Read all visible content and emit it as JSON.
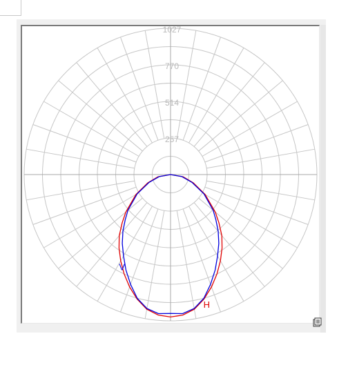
{
  "chart_data": {
    "type": "polar-line",
    "title": "",
    "radial_ticks": [
      "257",
      "514",
      "770",
      "1027"
    ],
    "radial_max": 1027,
    "angle_step_deg": 10,
    "series": [
      {
        "name": "H",
        "color": "#e00000",
        "label_angle_deg": 13,
        "angles_deg": [
          0,
          5,
          10,
          15,
          20,
          25,
          30,
          35,
          40,
          45,
          50,
          60,
          70,
          80,
          90
        ],
        "values": [
          1000,
          990,
          960,
          905,
          840,
          770,
          700,
          630,
          560,
          480,
          410,
          280,
          170,
          90,
          0
        ]
      },
      {
        "name": "V",
        "color": "#0000dd",
        "label_angle_deg": 25,
        "angles_deg": [
          0,
          5,
          10,
          15,
          20,
          25,
          30,
          35,
          40,
          45,
          50,
          60,
          70,
          80,
          90
        ],
        "values": [
          975,
          980,
          955,
          900,
          820,
          740,
          660,
          590,
          520,
          450,
          390,
          270,
          160,
          80,
          0
        ]
      }
    ]
  }
}
